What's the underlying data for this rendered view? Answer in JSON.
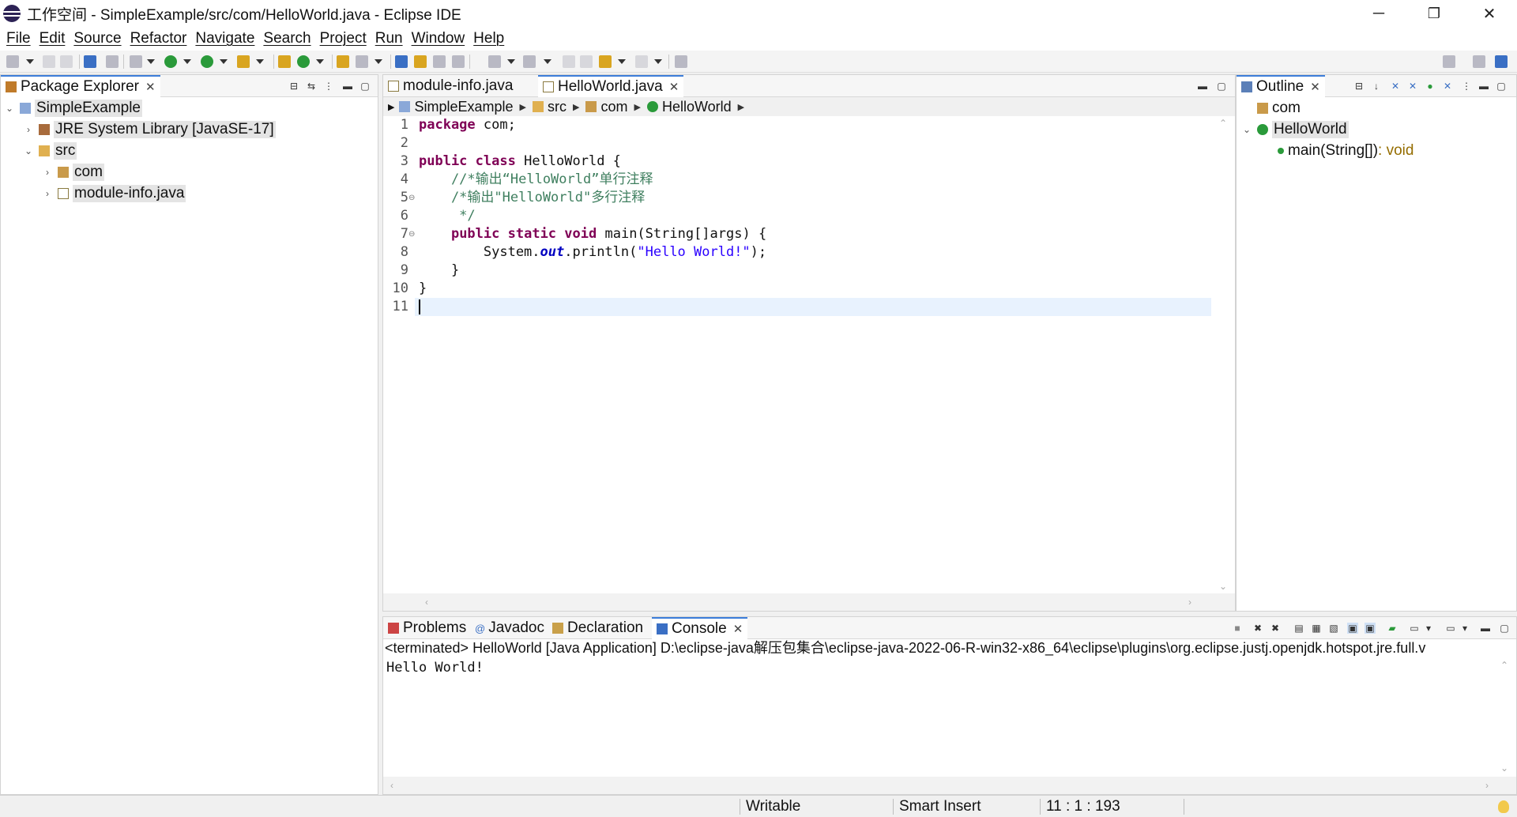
{
  "window": {
    "title": "工作空间 - SimpleExample/src/com/HelloWorld.java - Eclipse IDE",
    "minimize": "─",
    "restore": "❐",
    "close": "✕"
  },
  "menu": [
    "File",
    "Edit",
    "Source",
    "Refactor",
    "Navigate",
    "Search",
    "Project",
    "Run",
    "Window",
    "Help"
  ],
  "package_explorer": {
    "tab_label": "Package Explorer",
    "tree": [
      {
        "label": "SimpleExample",
        "twisty": "⌄",
        "icon": "project-icon"
      },
      {
        "label": "JRE System Library [JavaSE-17]",
        "twisty": "›",
        "icon": "library-icon"
      },
      {
        "label": "src",
        "twisty": "⌄",
        "icon": "source-folder-icon"
      },
      {
        "label": "com",
        "twisty": "›",
        "icon": "package-icon"
      },
      {
        "label": "module-info.java",
        "twisty": "›",
        "icon": "java-file-icon"
      }
    ]
  },
  "editor": {
    "tabs": [
      {
        "label": "module-info.java",
        "active": false
      },
      {
        "label": "HelloWorld.java",
        "active": true
      }
    ],
    "breadcrumb": [
      "SimpleExample",
      "src",
      "com",
      "HelloWorld"
    ],
    "line_numbers": [
      "1",
      "2",
      "3",
      "4",
      "5",
      "6",
      "7",
      "8",
      "9",
      "10",
      "11"
    ]
  },
  "outline": {
    "tab_label": "Outline",
    "items": [
      {
        "label": "com"
      },
      {
        "label": "HelloWorld"
      },
      {
        "label": "main(String[])",
        "suffix": " : void"
      }
    ]
  },
  "bottom_panel": {
    "tabs": [
      "Problems",
      "Javadoc",
      "Declaration",
      "Console"
    ],
    "active_tab": "Console",
    "console_header": "<terminated> HelloWorld [Java Application] D:\\eclipse-java解压包集合\\eclipse-java-2022-06-R-win32-x86_64\\eclipse\\plugins\\org.eclipse.justj.openjdk.hotspot.jre.full.v",
    "console_output": "Hello World!"
  },
  "status_bar": {
    "writable": "Writable",
    "insert_mode": "Smart Insert",
    "position": "11 : 1 : 193"
  },
  "colors": {
    "keyword": "#7f0055",
    "comment": "#3f7f5f",
    "string": "#2a00ff",
    "field": "#0000c0",
    "active_tab_accent": "#3c7dd9",
    "current_line": "#e8f2fe"
  }
}
